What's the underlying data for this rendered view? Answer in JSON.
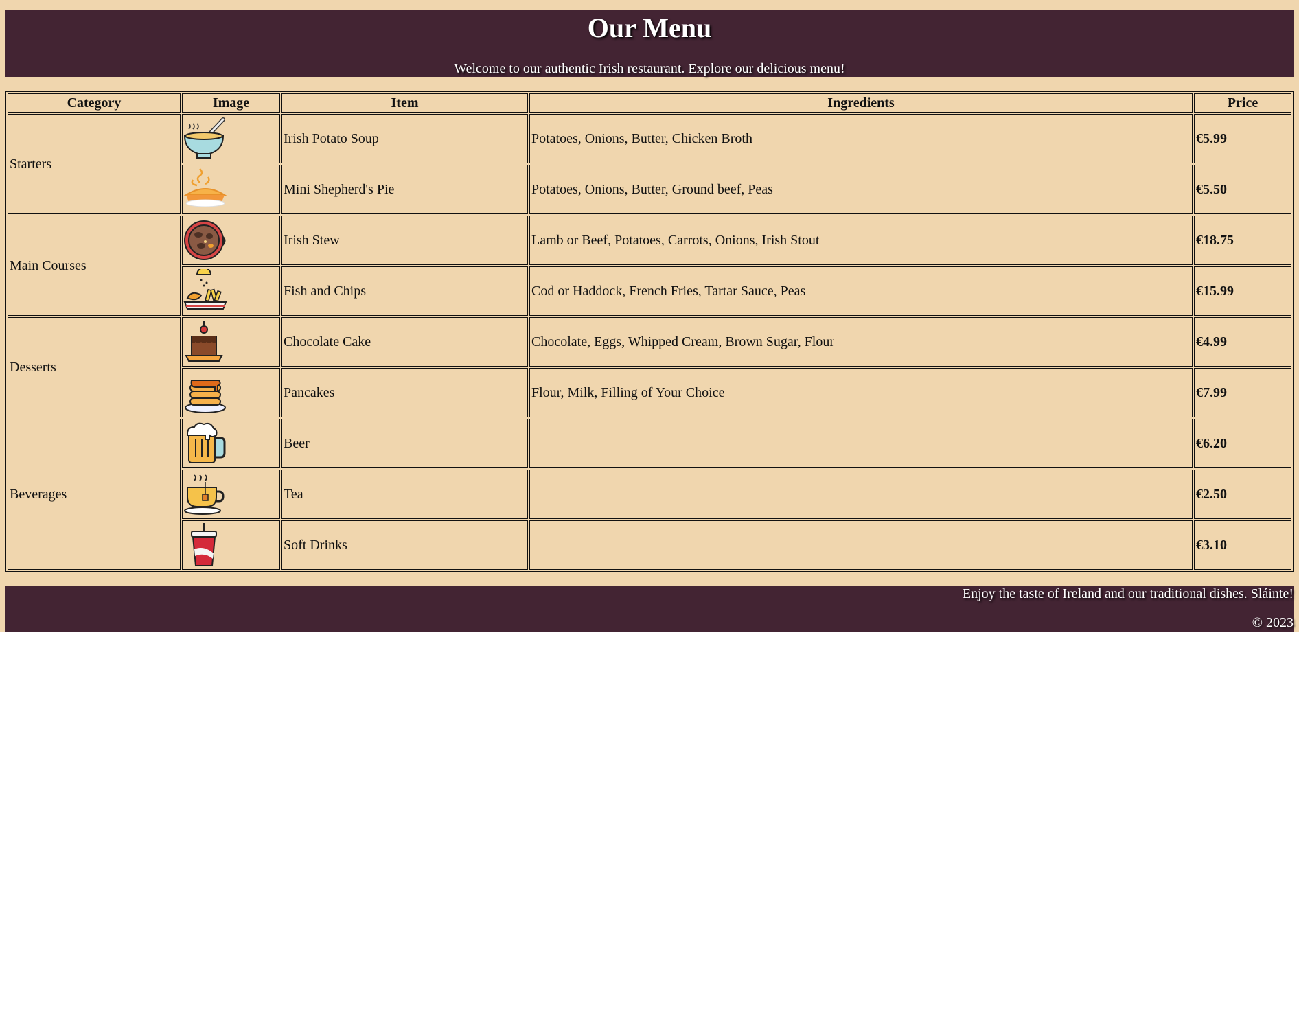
{
  "header": {
    "title": "Our Menu",
    "subtitle": "Welcome to our authentic Irish restaurant. Explore our delicious menu!"
  },
  "table": {
    "columns": [
      "Category",
      "Image",
      "Item",
      "Ingredients",
      "Price"
    ],
    "categories": [
      {
        "name": "Starters",
        "items": [
          {
            "icon": "soup-bowl-icon",
            "item": "Irish Potato Soup",
            "ingredients": "Potatoes, Onions, Butter, Chicken Broth",
            "price": "€5.99"
          },
          {
            "icon": "shepherds-pie-icon",
            "item": "Mini Shepherd's Pie",
            "ingredients": "Potatoes, Onions, Butter, Ground beef, Peas",
            "price": "€5.50"
          }
        ]
      },
      {
        "name": "Main Courses",
        "items": [
          {
            "icon": "stew-pan-icon",
            "item": "Irish Stew",
            "ingredients": "Lamb or Beef, Potatoes, Carrots, Onions, Irish Stout",
            "price": "€18.75"
          },
          {
            "icon": "fish-and-chips-icon",
            "item": "Fish and Chips",
            "ingredients": "Cod or Haddock, French Fries, Tartar Sauce, Peas",
            "price": "€15.99"
          }
        ]
      },
      {
        "name": "Desserts",
        "items": [
          {
            "icon": "chocolate-cake-icon",
            "item": "Chocolate Cake",
            "ingredients": "Chocolate, Eggs, Whipped Cream, Brown Sugar, Flour",
            "price": "€4.99"
          },
          {
            "icon": "pancakes-icon",
            "item": "Pancakes",
            "ingredients": "Flour, Milk, Filling of Your Choice",
            "price": "€7.99"
          }
        ]
      },
      {
        "name": "Beverages",
        "items": [
          {
            "icon": "beer-mug-icon",
            "item": "Beer",
            "ingredients": "",
            "price": "€6.20"
          },
          {
            "icon": "tea-cup-icon",
            "item": "Tea",
            "ingredients": "",
            "price": "€2.50"
          },
          {
            "icon": "soft-drink-cup-icon",
            "item": "Soft Drinks",
            "ingredients": "",
            "price": "€3.10"
          }
        ]
      }
    ]
  },
  "footer": {
    "tagline": "Enjoy the taste of Ireland and our traditional dishes. Sláinte!",
    "copyright": "© 2023"
  },
  "colors": {
    "page_background": "#f0d6ae",
    "banner_background": "#432433",
    "banner_text": "#ffffff"
  }
}
